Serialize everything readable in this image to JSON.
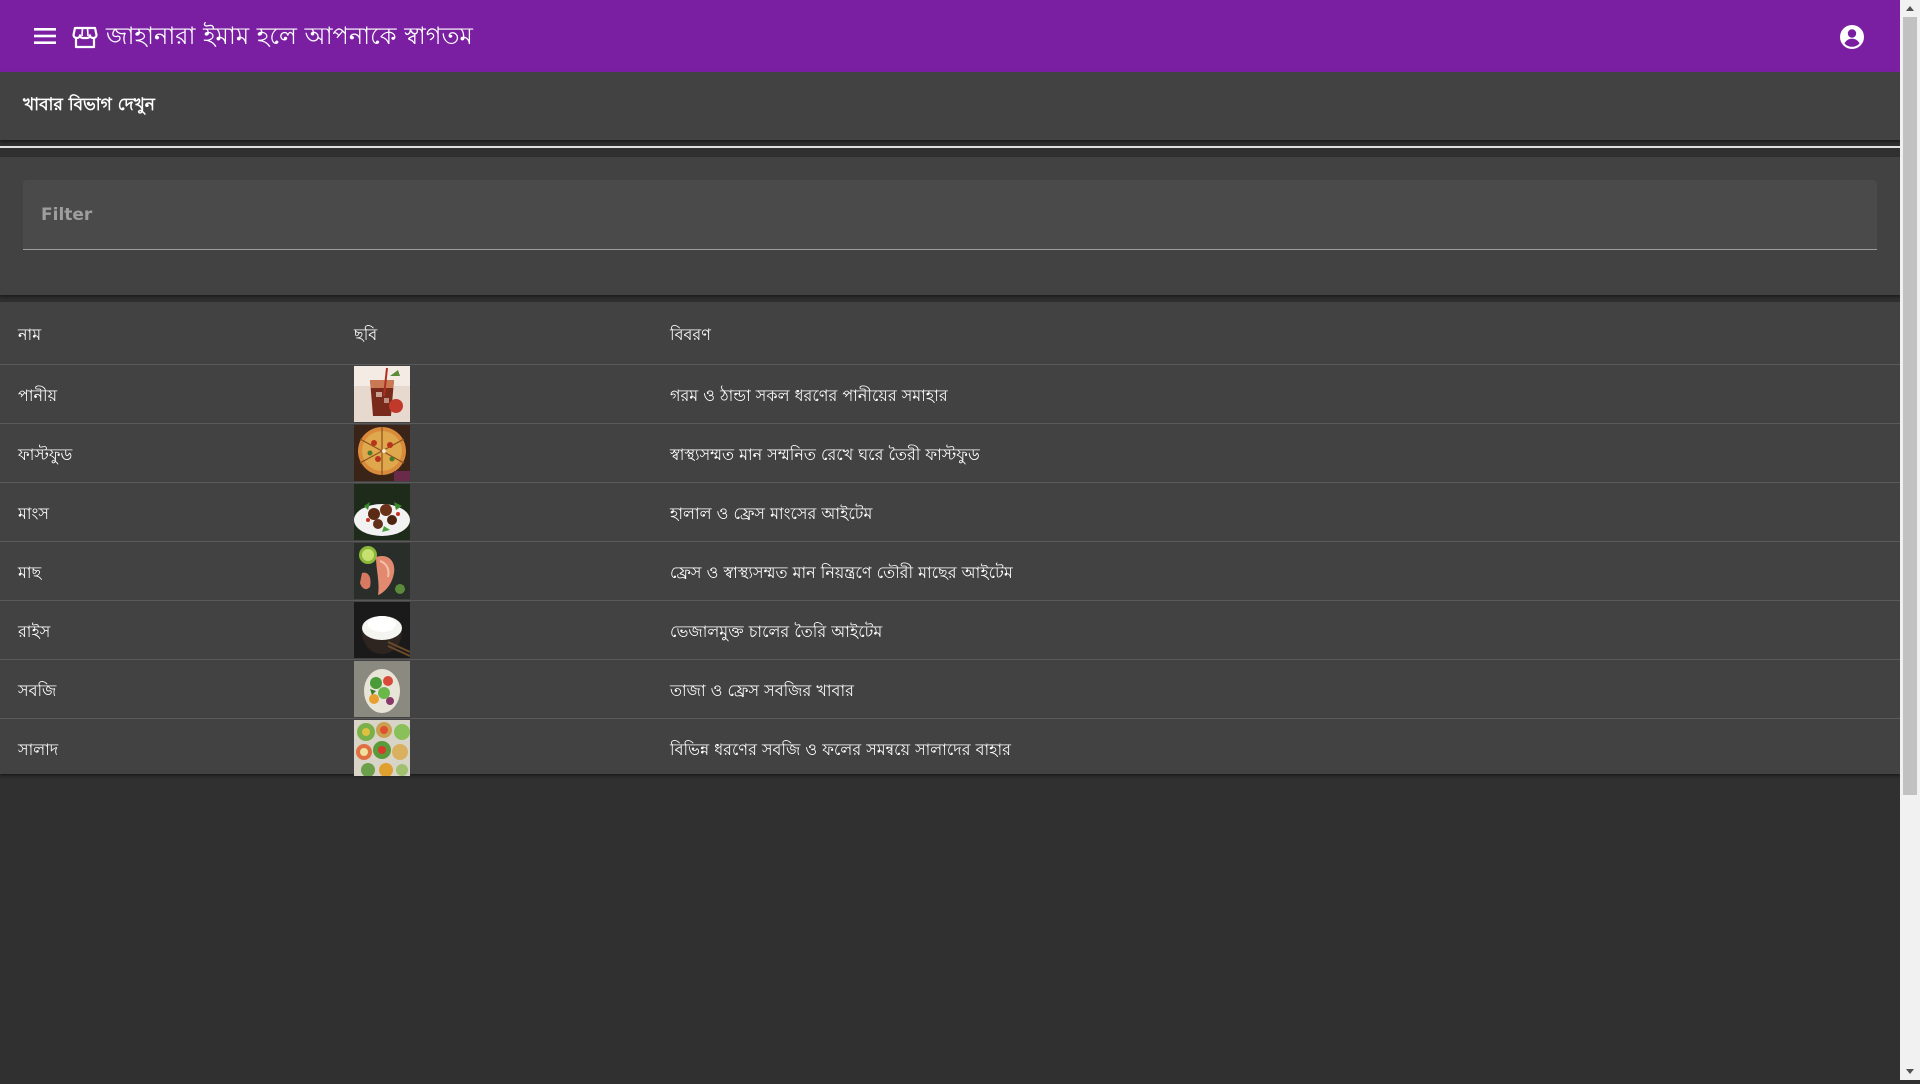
{
  "toolbar": {
    "title": "জাহানারা ইমাম হলে আপনাকে স্বাগতম",
    "bg_color": "#7b1fa2"
  },
  "card": {
    "title": "খাবার বিভাগ দেখুন"
  },
  "filter": {
    "placeholder": "Filter",
    "value": ""
  },
  "table": {
    "headers": {
      "name": "নাম",
      "image": "ছবি",
      "description": "বিবরণ"
    },
    "rows": [
      {
        "name": "পানীয়",
        "description": "গরম ও ঠান্ডা সকল ধরণের পানীয়ের সমাহার",
        "image_icon": "drinks-image"
      },
      {
        "name": "ফাস্টফুড",
        "description": "স্বাস্থ্যসম্মত মান সম্মনিত রেখে ঘরে তৈরী ফাস্টফুড",
        "image_icon": "pizza-image"
      },
      {
        "name": "মাংস",
        "description": "হালাল ও ফ্রেস মাংসের আইটেম",
        "image_icon": "meat-image"
      },
      {
        "name": "মাছ",
        "description": "ফ্রেস ও স্বাস্থ্যসম্মত মান নিয়ন্ত্রণে তৌরী মাছের আইটেম",
        "image_icon": "fish-image"
      },
      {
        "name": "রাইস",
        "description": "ভেজালমুক্ত চালের তৈরি আইটেম",
        "image_icon": "rice-image"
      },
      {
        "name": "সবজি",
        "description": "তাজা ও ফ্রেস সবজির খাবার",
        "image_icon": "vegetable-image"
      },
      {
        "name": "সালাদ",
        "description": "বিভিন্ন ধরণের সবজি ও ফলের সমন্বয়ে সালাদের বাহার",
        "image_icon": "salad-image"
      }
    ]
  }
}
